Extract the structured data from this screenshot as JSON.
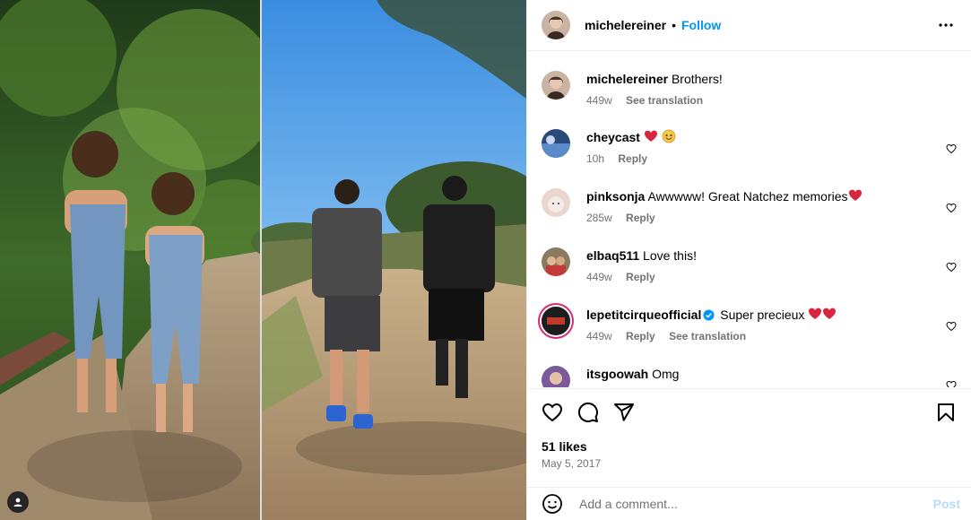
{
  "post": {
    "author": {
      "username": "michelereiner",
      "follow_label": "Follow",
      "separator": "•"
    },
    "more_icon": "more-options-icon",
    "tag_icon": "user-tag-icon"
  },
  "caption": {
    "username": "michelereiner",
    "text": "Brothers!",
    "time": "449w",
    "see_translation": "See translation"
  },
  "comments": [
    {
      "username": "cheycast",
      "text": "",
      "emojis": [
        "heart",
        "smiling-face"
      ],
      "time": "10h",
      "reply": "Reply",
      "avatar_color": "#3a5a9a"
    },
    {
      "username": "pinksonja",
      "text": "Awwwww! Great Natchez memories",
      "emojis": [
        "heart"
      ],
      "time": "285w",
      "reply": "Reply",
      "avatar_color": "#e9d6cc"
    },
    {
      "username": "elbaq511",
      "text": "Love this!",
      "emojis": [],
      "time": "449w",
      "reply": "Reply",
      "avatar_color": "#8a7a60"
    },
    {
      "username": "lepetitcirqueofficial",
      "text": "Super precieux",
      "emojis": [
        "heart",
        "heart"
      ],
      "time": "449w",
      "reply": "Reply",
      "see_translation": "See translation",
      "verified": true,
      "avatar_color": "#1d1d1d"
    },
    {
      "username": "itsgoowah",
      "text": "Omg",
      "emojis": [],
      "time": "",
      "reply": "",
      "avatar_color": "#7a5a9a"
    }
  ],
  "actions": {
    "like_icon": "heart-icon",
    "comment_icon": "comment-icon",
    "share_icon": "share-icon",
    "save_icon": "bookmark-icon",
    "likes": "51 likes",
    "date": "May 5, 2017"
  },
  "composer": {
    "placeholder": "Add a comment...",
    "post_label": "Post",
    "emoji_icon": "emoji-icon"
  },
  "colors": {
    "accent": "#0095f6",
    "muted": "#737373",
    "heart": "#d7263d"
  }
}
